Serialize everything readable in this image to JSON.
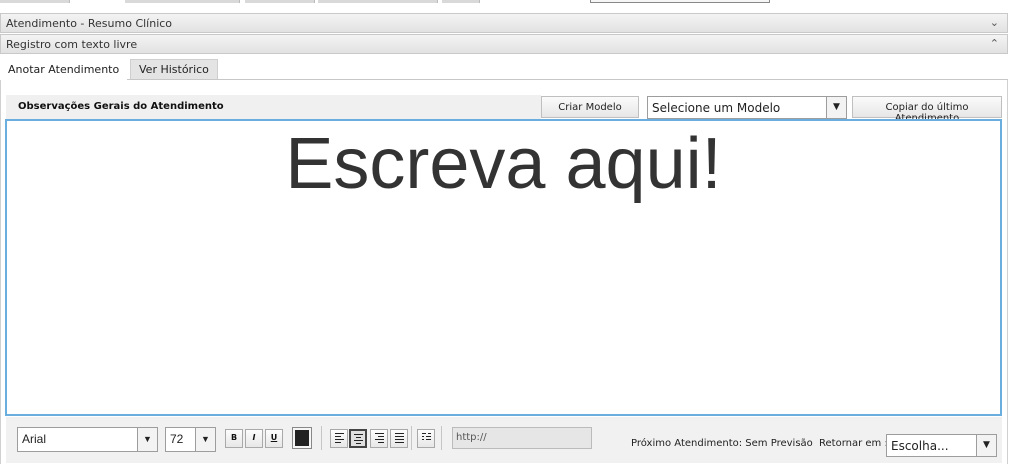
{
  "panels": {
    "resumo_title": "Atendimento - Resumo Clínico",
    "resumo_toggle": "⌄",
    "registro_title": "Registro com texto livre",
    "registro_toggle": "⌃"
  },
  "tabs": [
    {
      "label": "Anotar Atendimento",
      "active": true
    },
    {
      "label": "Ver Histórico",
      "active": false
    }
  ],
  "observacoes": {
    "title": "Observações Gerais do Atendimento",
    "criar_modelo_label": "Criar Modelo",
    "modelo_select_value": "Selecione um Modelo",
    "copiar_label": "Copiar do último Atendimento"
  },
  "editor": {
    "text": "Escreva aqui!"
  },
  "toolbar": {
    "font_value": "Arial",
    "size_value": "72",
    "bold_label": "B",
    "italic_label": "I",
    "underline_label": "U",
    "text_color": "#222222",
    "url_placeholder": "http://",
    "active_alignment": "center"
  },
  "footer": {
    "proximo_text": "Próximo Atendimento: Sem Previsão",
    "retornar_label": "Retornar em :",
    "retornar_value": "Escolha..."
  },
  "colors": {
    "editor_focus_border": "#6aaedf",
    "panel_header_bg": "#e8e8e8"
  }
}
